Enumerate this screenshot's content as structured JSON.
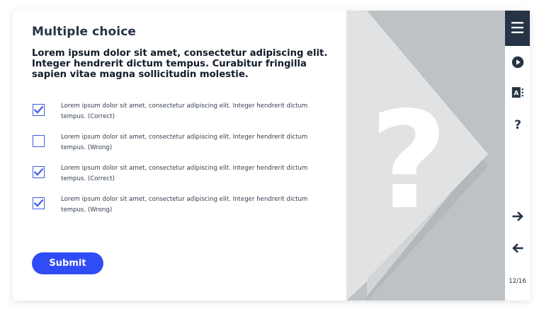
{
  "header": {
    "title": "Multiple choice"
  },
  "question": {
    "text": "Lorem ipsum dolor sit amet, consectetur adipiscing elit. Integer hendrerit dictum tempus. Curabitur fringilla sapien vitae magna sollicitudin molestie."
  },
  "options": [
    {
      "text": "Lorem ipsum dolor sit amet, consectetur adipiscing elit. Integer hendrerit dictum tempus.  (Correct)",
      "checked": true
    },
    {
      "text": "Lorem ipsum dolor sit amet, consectetur adipiscing elit. Integer hendrerit dictum tempus.  (Wrong)",
      "checked": false
    },
    {
      "text": "Lorem ipsum dolor sit amet, consectetur adipiscing elit. Integer hendrerit dictum tempus.  (Correct)",
      "checked": true
    },
    {
      "text": "Lorem ipsum dolor sit amet, consectetur adipiscing elit. Integer hendrerit dictum tempus.  (Wrong)",
      "checked": true
    }
  ],
  "actions": {
    "submit_label": "Submit"
  },
  "art": {
    "symbol": "?"
  },
  "sidebar": {
    "icons": [
      "menu-icon",
      "play-icon",
      "glossary-icon",
      "help-icon",
      "arrow-right-icon",
      "arrow-left-icon"
    ],
    "help_label": "?",
    "glossary_label": "A",
    "page_count": "12/16"
  },
  "colors": {
    "accent": "#2f4cf5",
    "dark": "#263445",
    "panel_gray": "#bfc2c4"
  }
}
